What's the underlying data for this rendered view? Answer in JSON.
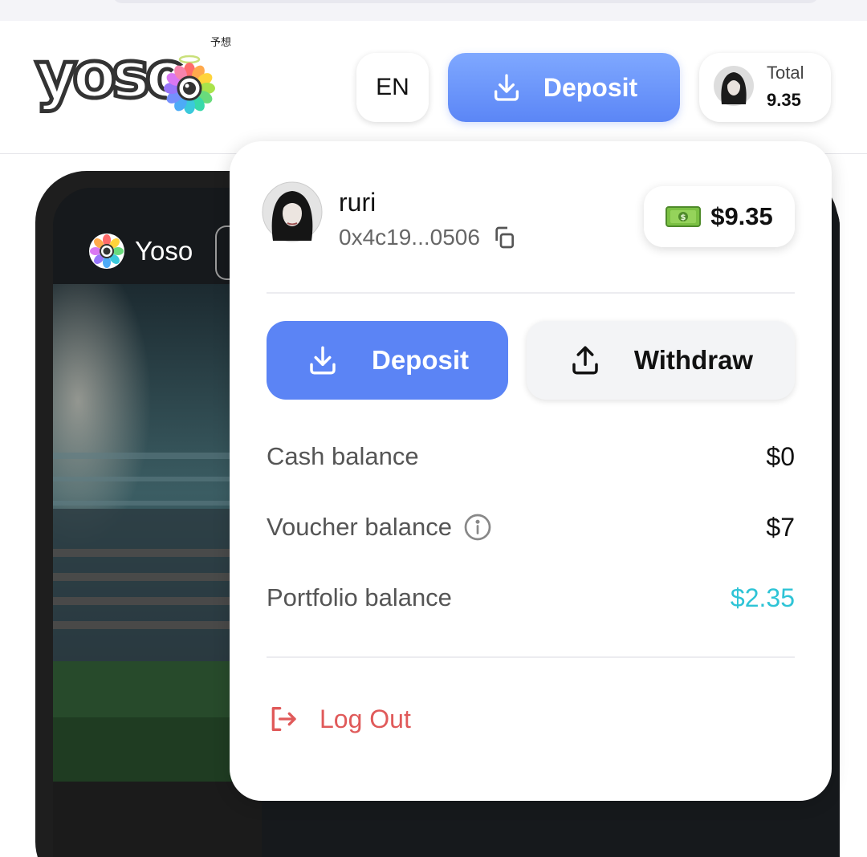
{
  "brand": {
    "logo_text": "yoso",
    "logo_jp": "予想",
    "mini_name": "Yoso"
  },
  "header": {
    "language": "EN",
    "deposit_label": "Deposit",
    "total_label": "Total",
    "total_value": "9.35"
  },
  "account_menu": {
    "username": "ruri",
    "wallet_address": "0x4c19...0506",
    "balance_chip": "$9.35",
    "deposit_label": "Deposit",
    "withdraw_label": "Withdraw",
    "rows": [
      {
        "label": "Cash balance",
        "value": "$0"
      },
      {
        "label": "Voucher balance",
        "value": "$7"
      },
      {
        "label": "Portfolio balance",
        "value": "$2.35"
      }
    ],
    "logout_label": "Log Out"
  },
  "colors": {
    "primary": "#5b84f5",
    "portfolio_accent": "#2ec4d6",
    "logout": "#e05a5a"
  },
  "icons": [
    "download-icon",
    "upload-icon",
    "copy-icon",
    "cash-icon",
    "info-icon",
    "logout-icon",
    "yoso-flower-icon"
  ]
}
